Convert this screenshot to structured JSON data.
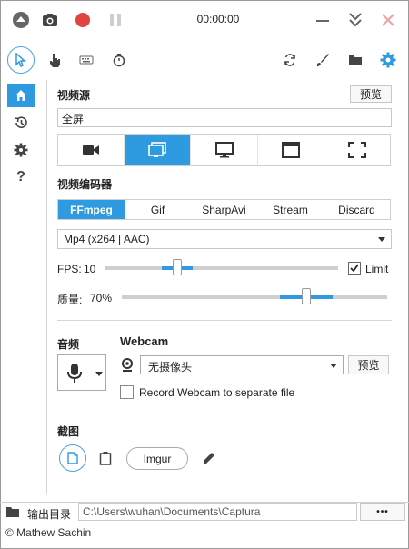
{
  "titlebar": {
    "timer": "00:00:00"
  },
  "video_source": {
    "label": "视频源",
    "preview_label": "预览",
    "current": "全屏",
    "tiles": [
      "webcam",
      "screen",
      "monitor",
      "window",
      "region"
    ],
    "selected_tile": "screen"
  },
  "encoder": {
    "label": "视频编码器",
    "tabs": [
      "FFmpeg",
      "Gif",
      "SharpAvi",
      "Stream",
      "Discard"
    ],
    "selected": "FFmpeg",
    "format": "Mp4 (x264 | AAC)"
  },
  "fps": {
    "label": "FPS:",
    "value": "10",
    "limit_label": "Limit",
    "limit_checked": true
  },
  "quality": {
    "label": "质量:",
    "value": "70%"
  },
  "audio": {
    "label": "音频"
  },
  "webcam": {
    "label": "Webcam",
    "device": "无摄像头",
    "preview_label": "预览",
    "separate_label": "Record Webcam to separate file"
  },
  "screenshot": {
    "label": "截图",
    "imgur_label": "Imgur"
  },
  "output": {
    "label": "输出目录",
    "path": "C:\\Users\\wuhan\\Documents\\Captura",
    "more_label": "•••"
  },
  "footer": {
    "copyright": "© Mathew Sachin"
  },
  "colors": {
    "accent": "#2e9ae0",
    "record_red": "#e0443e"
  }
}
